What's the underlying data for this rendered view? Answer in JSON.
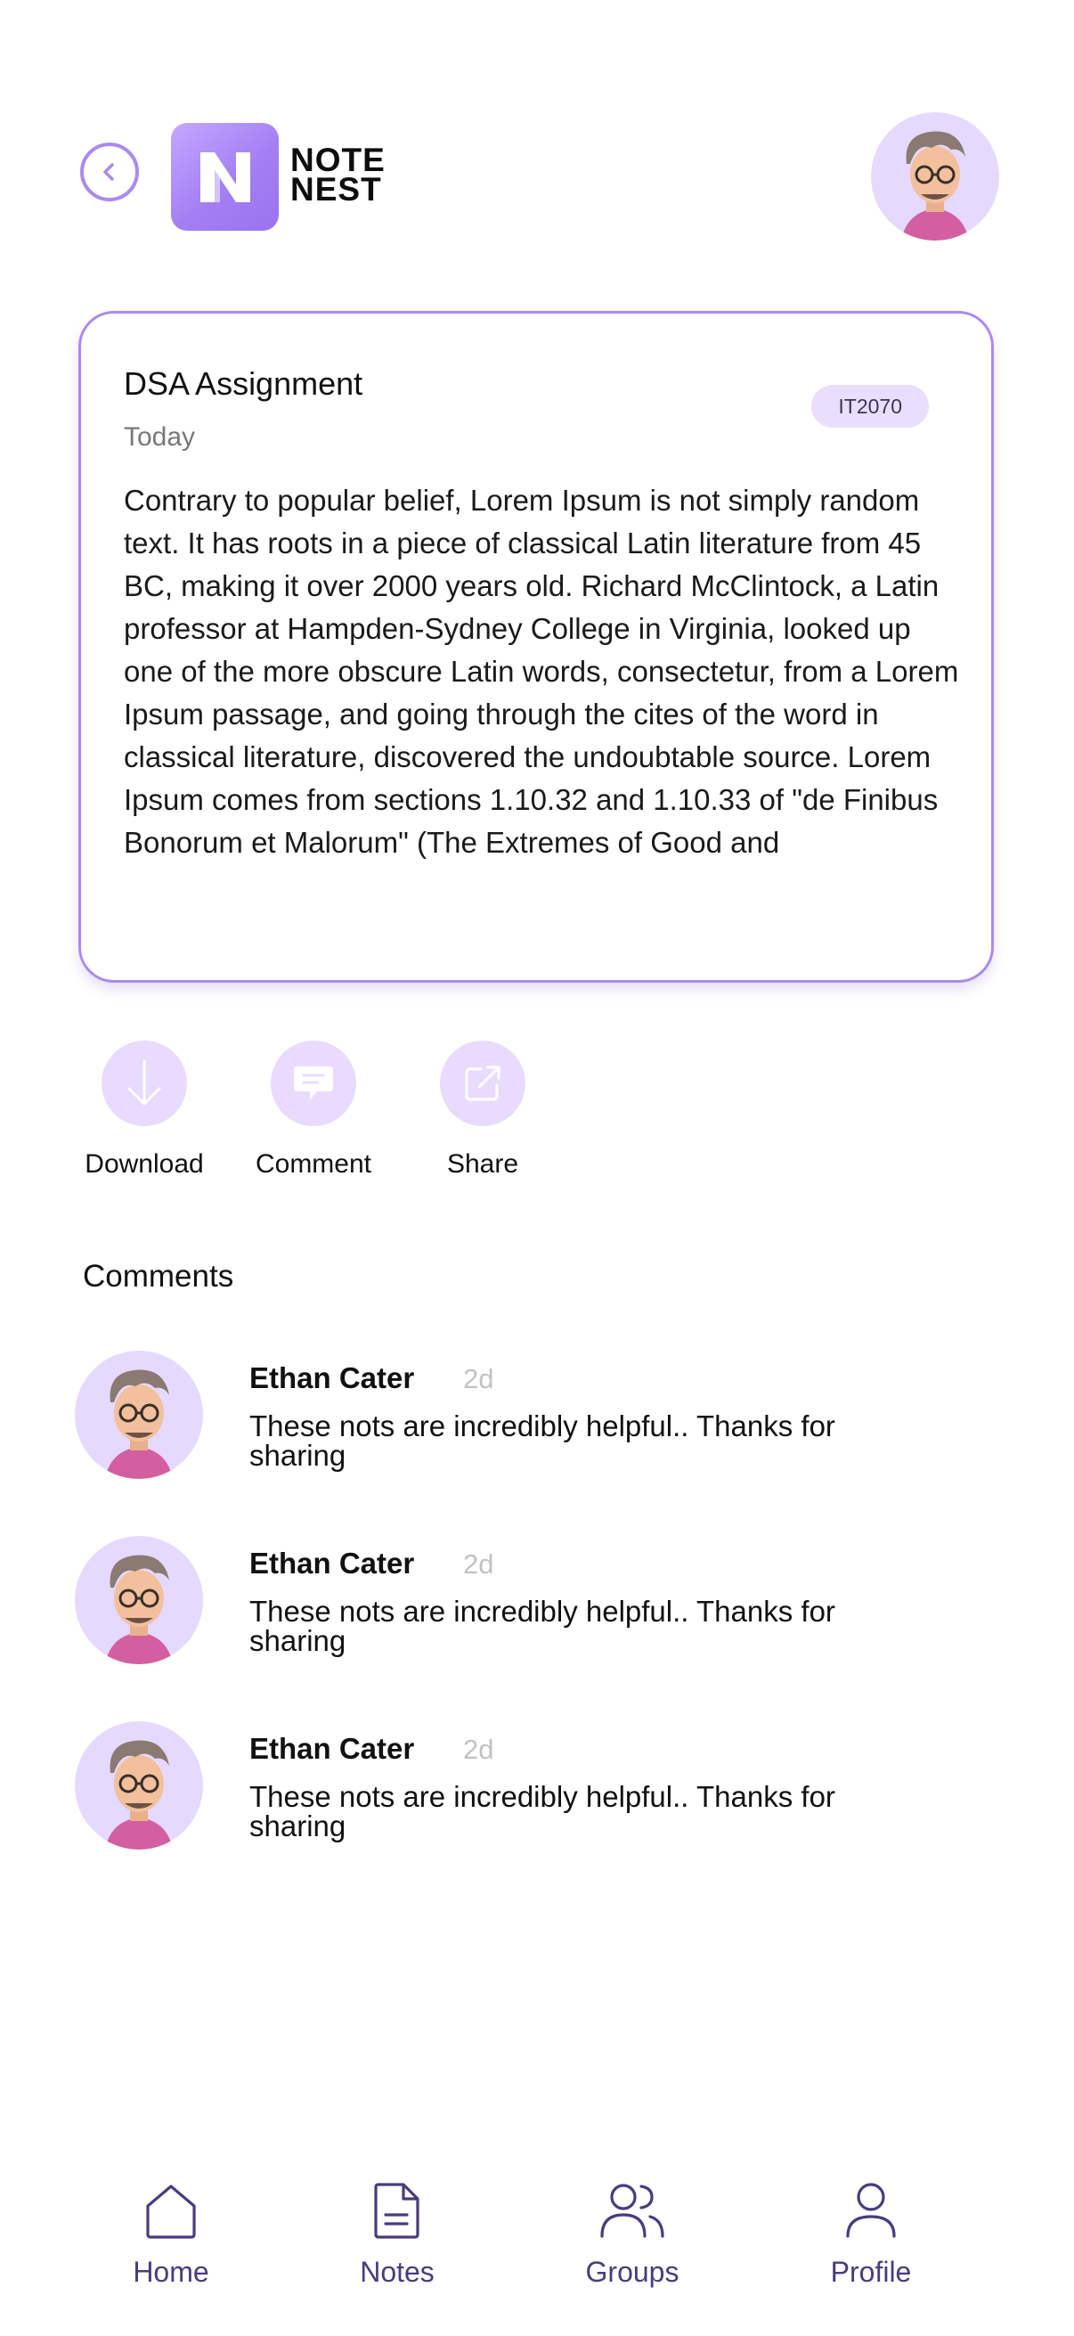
{
  "header": {
    "logo_initial": "N",
    "logo_line1": "Note",
    "logo_line2": "Nest"
  },
  "note": {
    "title": "DSA Assignment",
    "date": "Today",
    "tag": "IT2070",
    "body": "Contrary to popular belief, Lorem Ipsum is not simply random text. It has roots in a piece of classical Latin literature from 45 BC, making it over 2000 years old. Richard McClintock, a Latin professor at Hampden-Sydney College in Virginia, looked up one of the more obscure Latin words, consectetur, from a Lorem Ipsum passage, and going through the cites of the word in classical literature, discovered the undoubtable source. Lorem Ipsum comes from sections 1.10.32 and 1.10.33 of \"de Finibus Bonorum et Malorum\" (The Extremes of Good and"
  },
  "actions": [
    {
      "label": "Download",
      "icon": "download-icon"
    },
    {
      "label": "Comment",
      "icon": "comment-icon"
    },
    {
      "label": "Share",
      "icon": "share-icon"
    }
  ],
  "comments": {
    "title": "Comments",
    "items": [
      {
        "name": "Ethan Cater",
        "time": "2d",
        "text": "These nots are incredibly helpful.. Thanks for sharing"
      },
      {
        "name": "Ethan Cater",
        "time": "2d",
        "text": "These nots are incredibly helpful.. Thanks for sharing"
      },
      {
        "name": "Ethan Cater",
        "time": "2d",
        "text": "These nots are incredibly helpful.. Thanks for sharing"
      }
    ]
  },
  "nav": [
    {
      "label": "Home",
      "icon": "home-icon"
    },
    {
      "label": "Notes",
      "icon": "notes-icon"
    },
    {
      "label": "Groups",
      "icon": "groups-icon"
    },
    {
      "label": "Profile",
      "icon": "profile-icon"
    }
  ],
  "colors": {
    "accent": "#a98af0",
    "accent_light": "#e8dbff",
    "nav_text": "#4a3b7d"
  }
}
